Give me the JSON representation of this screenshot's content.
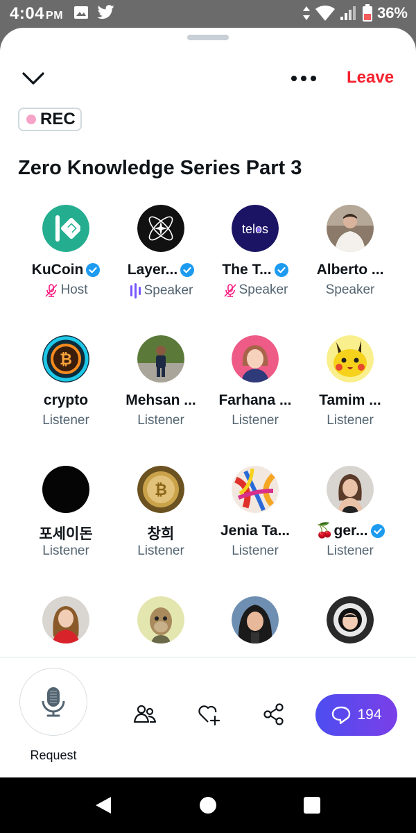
{
  "status_bar": {
    "time": "4:04",
    "ampm": "PM",
    "battery": "36%",
    "icons": [
      "image-icon",
      "twitter-icon",
      "data-arrows-icon",
      "wifi-icon",
      "signal-icon",
      "battery-icon"
    ]
  },
  "header": {
    "collapse_icon": "chevron-down-icon",
    "more_icon": "more-horizontal-icon",
    "leave_label": "Leave",
    "leave_color": "#f4212e"
  },
  "rec_badge": {
    "label": "REC",
    "dot_color": "#f6a3c8"
  },
  "space": {
    "title": "Zero Knowledge Series Part 3"
  },
  "participants": [
    {
      "name": "KuCoin",
      "role": "Host",
      "verified": true,
      "role_icon": "mic-muted-icon",
      "avatar": "kucoin-logo"
    },
    {
      "name": "Layer...",
      "role": "Speaker",
      "verified": true,
      "role_icon": "speaking-bars-icon",
      "avatar": "layer-logo"
    },
    {
      "name": "The T...",
      "role": "Speaker",
      "verified": true,
      "role_icon": "mic-muted-icon",
      "avatar": "telos-logo",
      "avatar_text": "telos"
    },
    {
      "name": "Alberto ...",
      "role": "Speaker",
      "verified": false,
      "avatar": "photo"
    },
    {
      "name": "crypto",
      "role": "Listener",
      "verified": false,
      "avatar": "bitcoin-coin"
    },
    {
      "name": "Mehsan ...",
      "role": "Listener",
      "verified": false,
      "avatar": "photo"
    },
    {
      "name": "Farhana ...",
      "role": "Listener",
      "verified": false,
      "avatar": "illustration"
    },
    {
      "name": "Tamim ...",
      "role": "Listener",
      "verified": false,
      "avatar": "pikachu"
    },
    {
      "name": "포세이돈",
      "role": "Listener",
      "verified": false,
      "avatar": "black-circle"
    },
    {
      "name": "창희",
      "role": "Listener",
      "verified": false,
      "avatar": "gold-bitcoin"
    },
    {
      "name": "Jenia Ta...",
      "role": "Listener",
      "verified": false,
      "avatar": "colorful-art"
    },
    {
      "name": "🍒ger...",
      "role": "Listener",
      "verified": true,
      "avatar": "photo"
    },
    {
      "name": "",
      "role": "",
      "verified": false,
      "avatar": "photo"
    },
    {
      "name": "",
      "role": "",
      "verified": false,
      "avatar": "ape-nft"
    },
    {
      "name": "",
      "role": "",
      "verified": false,
      "avatar": "hooded-figure"
    },
    {
      "name": "",
      "role": "",
      "verified": false,
      "avatar": "astronaut"
    }
  ],
  "bottom_bar": {
    "request_label": "Request",
    "mic_icon": "microphone-icon",
    "people_icon": "people-icon",
    "reaction_icon": "heart-plus-icon",
    "share_icon": "share-icon",
    "chat_count": "194",
    "chat_icon": "chat-bubble-icon",
    "accent": "#5b47f5"
  },
  "nav_bar": {
    "back_icon": "back-triangle-icon",
    "home_icon": "home-circle-icon",
    "recents_icon": "recents-square-icon"
  }
}
